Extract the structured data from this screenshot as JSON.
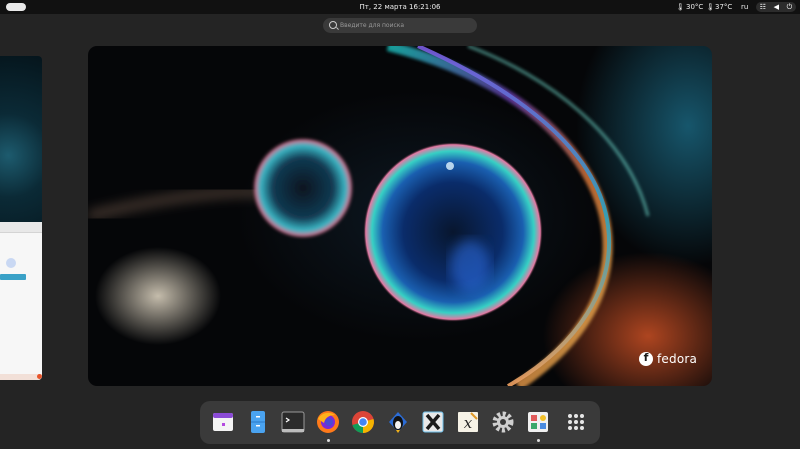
{
  "topbar": {
    "clock": "Пт, 22 марта  16:21:06",
    "temp1": "30°C",
    "temp2": "37°C",
    "lang": "ru"
  },
  "search": {
    "placeholder": "Введите для поиска"
  },
  "main_window": {
    "logo_text": "fedora"
  },
  "dock": {
    "items": [
      {
        "name": "calendar",
        "running": false
      },
      {
        "name": "files",
        "running": false
      },
      {
        "name": "terminal",
        "running": false
      },
      {
        "name": "firefox",
        "running": true
      },
      {
        "name": "chrome",
        "running": false
      },
      {
        "name": "linux-app",
        "running": false
      },
      {
        "name": "xmind",
        "running": false
      },
      {
        "name": "xournal",
        "running": false
      },
      {
        "name": "settings",
        "running": false
      },
      {
        "name": "software",
        "running": true
      },
      {
        "name": "app-grid",
        "running": false
      }
    ]
  }
}
